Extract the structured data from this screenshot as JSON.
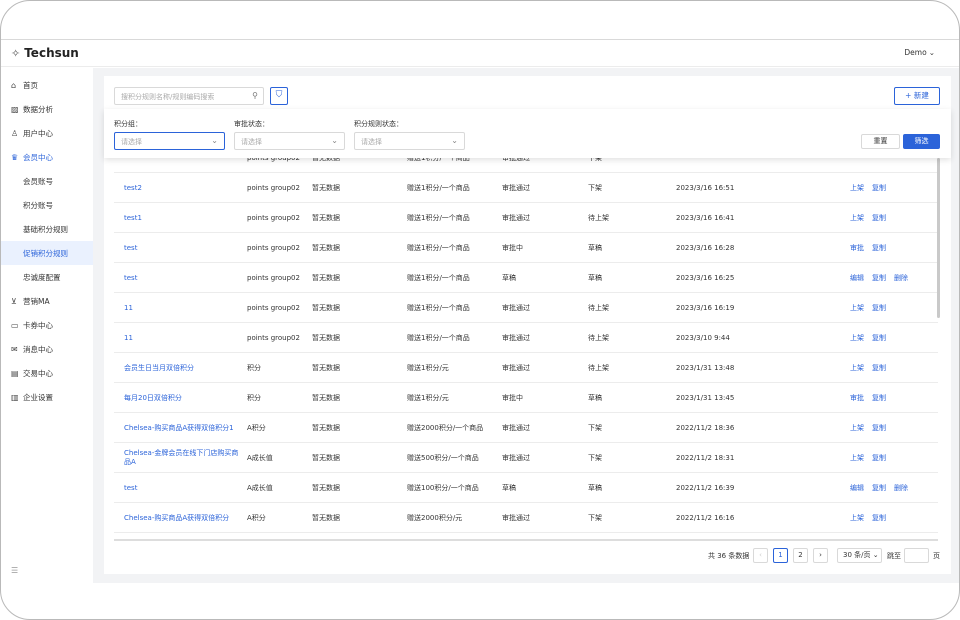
{
  "app": {
    "logo": "Techsun",
    "user": "Demo"
  },
  "sidebar": {
    "items": [
      {
        "label": "首页",
        "icon": "home-icon",
        "glyph": "⌂"
      },
      {
        "label": "数据分析",
        "icon": "chart-icon",
        "glyph": "▨"
      },
      {
        "label": "用户中心",
        "icon": "users-icon",
        "glyph": "♙"
      },
      {
        "label": "会员中心",
        "icon": "member-icon",
        "glyph": "♛"
      },
      {
        "label": "营销MA",
        "icon": "cart-icon",
        "glyph": "⊻"
      },
      {
        "label": "卡券中心",
        "icon": "card-icon",
        "glyph": "▭"
      },
      {
        "label": "消息中心",
        "icon": "mail-icon",
        "glyph": "✉"
      },
      {
        "label": "交易中心",
        "icon": "trade-icon",
        "glyph": "▤"
      },
      {
        "label": "企业设置",
        "icon": "building-icon",
        "glyph": "▥"
      }
    ],
    "sub_items": [
      "会员账号",
      "积分账号",
      "基础积分规则",
      "促销积分规则",
      "忠诚度配置"
    ]
  },
  "toolbar": {
    "search_placeholder": "搜积分规则名称/规则编码搜索",
    "new_label": "新建"
  },
  "filters": {
    "group_label": "积分组：",
    "approval_label": "审批状态：",
    "status_label": "积分规则状态：",
    "placeholder": "请选择",
    "reset_label": "重置",
    "apply_label": "筛选"
  },
  "table": {
    "partial_row": [
      "",
      "points group02",
      "暂无数据",
      "赠送1积分/一个商品",
      "审批通过",
      "下架",
      ""
    ],
    "rows": [
      {
        "name": "test2",
        "group": "points group02",
        "data": "暂无数据",
        "rule": "赠送1积分/一个商品",
        "approval": "审批通过",
        "status": "下架",
        "time": "2023/3/16 16:51",
        "actions": [
          "上架",
          "复制"
        ]
      },
      {
        "name": "test1",
        "group": "points group02",
        "data": "暂无数据",
        "rule": "赠送1积分/一个商品",
        "approval": "审批通过",
        "status": "待上架",
        "time": "2023/3/16 16:41",
        "actions": [
          "上架",
          "复制"
        ]
      },
      {
        "name": "test",
        "group": "points group02",
        "data": "暂无数据",
        "rule": "赠送1积分/一个商品",
        "approval": "审批中",
        "status": "草稿",
        "time": "2023/3/16 16:28",
        "actions": [
          "审批",
          "复制"
        ]
      },
      {
        "name": "test",
        "group": "points group02",
        "data": "暂无数据",
        "rule": "赠送1积分/一个商品",
        "approval": "草稿",
        "status": "草稿",
        "time": "2023/3/16 16:25",
        "actions": [
          "编辑",
          "复制",
          "删除"
        ]
      },
      {
        "name": "11",
        "group": "points group02",
        "data": "暂无数据",
        "rule": "赠送1积分/一个商品",
        "approval": "审批通过",
        "status": "待上架",
        "time": "2023/3/16 16:19",
        "actions": [
          "上架",
          "复制"
        ]
      },
      {
        "name": "11",
        "group": "points group02",
        "data": "暂无数据",
        "rule": "赠送1积分/一个商品",
        "approval": "审批通过",
        "status": "待上架",
        "time": "2023/3/10 9:44",
        "actions": [
          "上架",
          "复制"
        ]
      },
      {
        "name": "会员生日当月双倍积分",
        "group": "积分",
        "data": "暂无数据",
        "rule": "赠送1积分/元",
        "approval": "审批通过",
        "status": "待上架",
        "time": "2023/1/31 13:48",
        "actions": [
          "上架",
          "复制"
        ]
      },
      {
        "name": "每月20日双倍积分",
        "group": "积分",
        "data": "暂无数据",
        "rule": "赠送1积分/元",
        "approval": "审批中",
        "status": "草稿",
        "time": "2023/1/31 13:45",
        "actions": [
          "审批",
          "复制"
        ]
      },
      {
        "name": "Chelsea-购买商品A获得双倍积分1",
        "group": "A积分",
        "data": "暂无数据",
        "rule": "赠送2000积分/一个商品",
        "approval": "审批通过",
        "status": "下架",
        "time": "2022/11/2 18:36",
        "actions": [
          "上架",
          "复制"
        ]
      },
      {
        "name": "Chelsea-金牌会员在线下门店购买商品A",
        "group": "A成长值",
        "data": "暂无数据",
        "rule": "赠送500积分/一个商品",
        "approval": "审批通过",
        "status": "下架",
        "time": "2022/11/2 18:31",
        "actions": [
          "上架",
          "复制"
        ]
      },
      {
        "name": "test",
        "group": "A成长值",
        "data": "暂无数据",
        "rule": "赠送100积分/一个商品",
        "approval": "草稿",
        "status": "草稿",
        "time": "2022/11/2 16:39",
        "actions": [
          "编辑",
          "复制",
          "删除"
        ]
      },
      {
        "name": "Chelsea-购买商品A获得双倍积分",
        "group": "A积分",
        "data": "暂无数据",
        "rule": "赠送2000积分/元",
        "approval": "审批通过",
        "status": "下架",
        "time": "2022/11/2 16:16",
        "actions": [
          "上架",
          "复制"
        ]
      }
    ]
  },
  "pagination": {
    "total": "共 36 条数据",
    "pages": [
      "1",
      "2"
    ],
    "current": "1",
    "page_size": "30 条/页",
    "jump_label": "跳至",
    "page_label": "页"
  }
}
